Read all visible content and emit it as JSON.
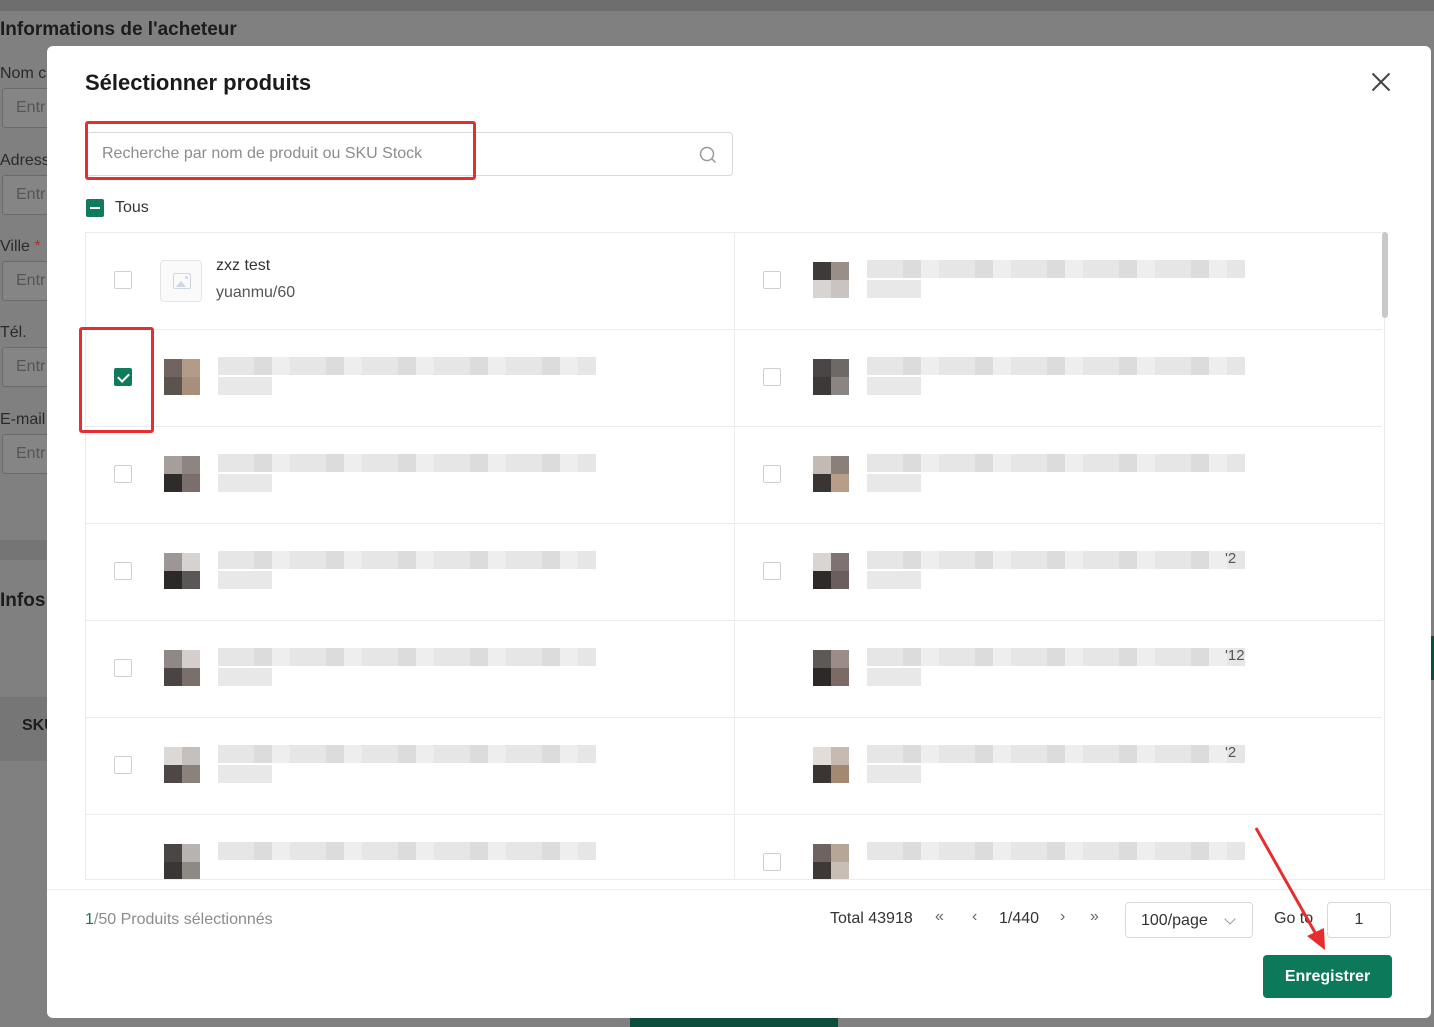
{
  "background": {
    "page_title": "Informations de l'acheteur",
    "fields": [
      {
        "label": "Nom c",
        "placeholder": "Entr",
        "required": false
      },
      {
        "label": "Adress",
        "placeholder": "Entr",
        "required": false
      },
      {
        "label": "Ville",
        "placeholder": "Entr",
        "required": true
      },
      {
        "label": "Tél.",
        "placeholder": "Entr",
        "required": false
      },
      {
        "label": "E-mail",
        "placeholder": "Entr",
        "required": false
      }
    ],
    "required_mark": "*",
    "section_title": "Infos",
    "table_header": "SKU"
  },
  "modal": {
    "title": "Sélectionner produits",
    "search_placeholder": "Recherche par nom de produit ou SKU Stock",
    "select_all_label": "Tous",
    "products": [
      {
        "name": "zxz test",
        "sku": "yuanmu/60",
        "checked": false,
        "blurred": false
      },
      {
        "name": "",
        "sku": "",
        "checked": true,
        "blurred": true
      },
      {
        "name": "",
        "sku": "",
        "checked": false,
        "blurred": true
      },
      {
        "name": "",
        "sku": "",
        "checked": false,
        "blurred": true
      },
      {
        "name": "",
        "sku": "",
        "checked": false,
        "blurred": true
      },
      {
        "name": "",
        "sku": "",
        "checked": false,
        "blurred": true
      },
      {
        "name": "",
        "sku": "",
        "checked": false,
        "blurred": true
      }
    ],
    "products_right": [
      {
        "suffix": "",
        "checked": false
      },
      {
        "suffix": "",
        "checked": false
      },
      {
        "suffix": "",
        "checked": false
      },
      {
        "suffix": "'2",
        "checked": false
      },
      {
        "suffix": "'12",
        "checked": false
      },
      {
        "suffix": "'2",
        "checked": false
      },
      {
        "suffix": "",
        "checked": false
      }
    ],
    "footer": {
      "selected_count": "1",
      "selected_rest": "/50 Produits sélectionnés",
      "total": "Total 43918",
      "first_page": "«",
      "prev_page": "‹",
      "page_indicator": "1/440",
      "next_page": "›",
      "last_page": "»",
      "page_size": "100/page",
      "goto_label": "Go to",
      "goto_value": "1",
      "save_label": "Enregistrer"
    }
  },
  "colors": {
    "accent": "#0f7a5c",
    "annotation": "#e62e2e"
  }
}
